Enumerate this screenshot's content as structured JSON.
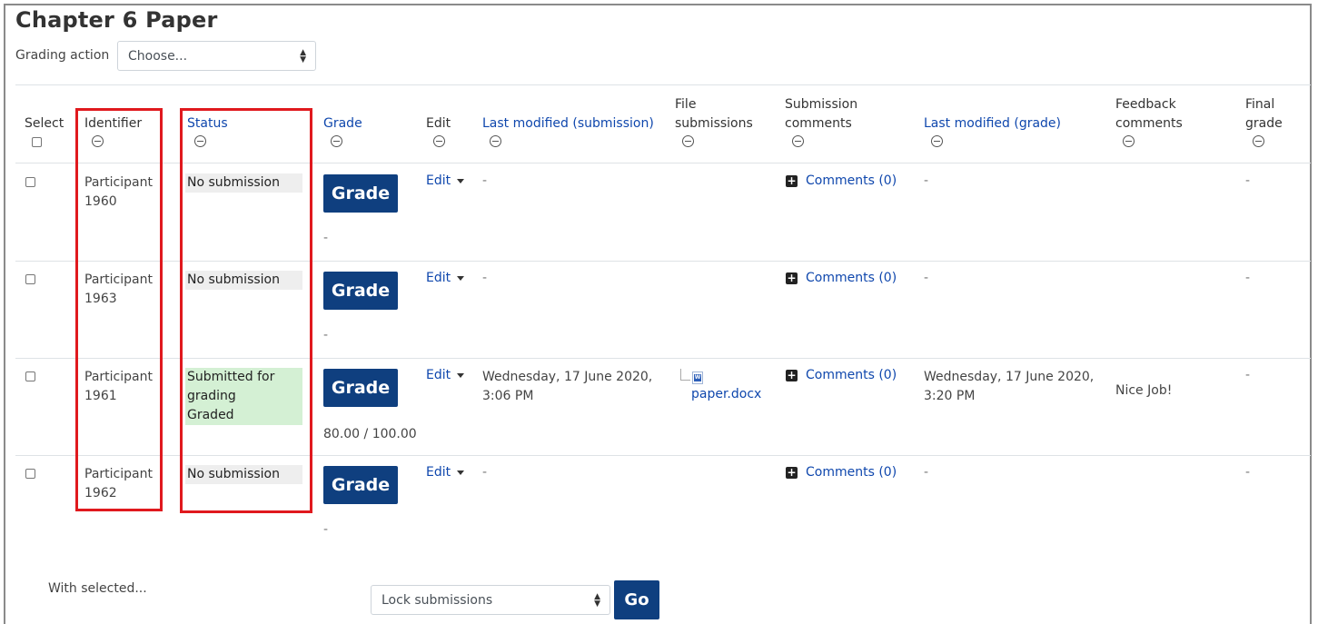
{
  "page": {
    "title": "Chapter 6 Paper"
  },
  "grading_action": {
    "label": "Grading action",
    "selected": "Choose..."
  },
  "columns": {
    "select": "Select",
    "identifier": "Identifier",
    "status": "Status",
    "grade": "Grade",
    "edit": "Edit",
    "last_modified_submission": "Last modified (submission)",
    "file_submissions": [
      "File",
      "submissions"
    ],
    "submission_comments": [
      "Submission",
      "comments"
    ],
    "last_modified_grade": "Last modified (grade)",
    "feedback_comments": [
      "Feedback",
      "comments"
    ],
    "final_grade": [
      "Final",
      "grade"
    ]
  },
  "rows": [
    {
      "identifier": [
        "Participant",
        "1960"
      ],
      "status": [
        "No submission"
      ],
      "status_type": "none",
      "grade_button": "Grade",
      "grade_value": "-",
      "edit": "Edit",
      "last_modified_submission": [
        "-"
      ],
      "file": "",
      "comments": "Comments (0)",
      "last_modified_grade": [
        "-"
      ],
      "feedback": "",
      "final_grade": "-"
    },
    {
      "identifier": [
        "Participant",
        "1963"
      ],
      "status": [
        "No submission"
      ],
      "status_type": "none",
      "grade_button": "Grade",
      "grade_value": "-",
      "edit": "Edit",
      "last_modified_submission": [
        "-"
      ],
      "file": "",
      "comments": "Comments (0)",
      "last_modified_grade": [
        "-"
      ],
      "feedback": "",
      "final_grade": "-"
    },
    {
      "identifier": [
        "Participant",
        "1961"
      ],
      "status": [
        "Submitted for",
        "grading",
        "Graded"
      ],
      "status_type": "graded",
      "grade_button": "Grade",
      "grade_value": "80.00 / 100.00",
      "edit": "Edit",
      "last_modified_submission": [
        "Wednesday, 17 June 2020,",
        "3:06 PM"
      ],
      "file": "paper.docx",
      "comments": "Comments (0)",
      "last_modified_grade": [
        "Wednesday, 17 June 2020,",
        "3:20 PM"
      ],
      "feedback": "Nice Job!",
      "final_grade": "-"
    },
    {
      "identifier": [
        "Participant",
        "1962"
      ],
      "status": [
        "No submission"
      ],
      "status_type": "none",
      "grade_button": "Grade",
      "grade_value": "-",
      "edit": "Edit",
      "last_modified_submission": [
        "-"
      ],
      "file": "",
      "comments": "Comments (0)",
      "last_modified_grade": [
        "-"
      ],
      "feedback": "",
      "final_grade": "-"
    }
  ],
  "footer": {
    "with_selected": "With selected...",
    "bulk_action": "Lock submissions",
    "go": "Go"
  },
  "colors": {
    "link": "#0f47ad",
    "button": "#0f3f7f",
    "highlight": "#e0191e",
    "graded_bg": "#d4f0d4"
  }
}
